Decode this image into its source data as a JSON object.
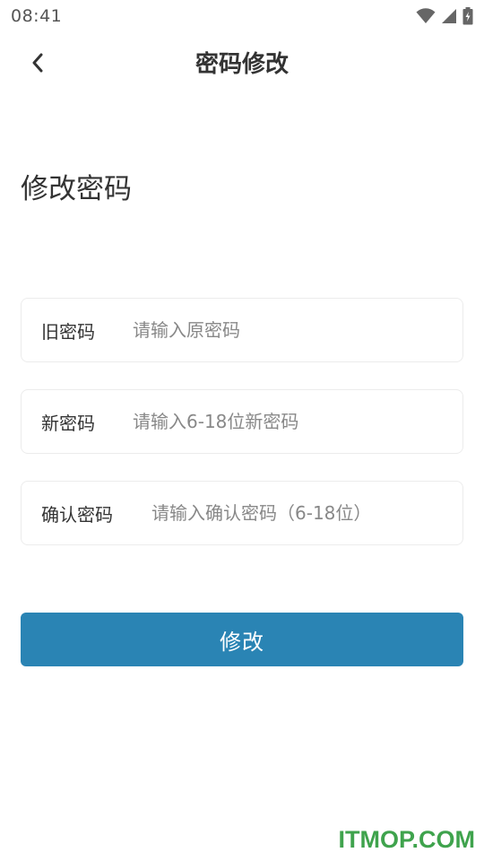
{
  "status_bar": {
    "time": "08:41",
    "icons": [
      "wifi-icon",
      "cellular-signal-icon",
      "battery-charging-icon"
    ]
  },
  "header": {
    "title": "密码修改",
    "back_icon": "chevron-left-icon"
  },
  "section": {
    "heading": "修改密码"
  },
  "form": {
    "old_password": {
      "label": "旧密码",
      "value": "",
      "placeholder": "请输入原密码"
    },
    "new_password": {
      "label": "新密码",
      "value": "",
      "placeholder": "请输入6-18位新密码"
    },
    "confirm_password": {
      "label": "确认密码",
      "value": "",
      "placeholder": "请输入确认密码（6-18位）"
    },
    "submit_label": "修改"
  },
  "watermark": {
    "text": "ITMOP.COM"
  },
  "colors": {
    "accent": "#2a84b4",
    "watermark": "#3fa34d"
  }
}
